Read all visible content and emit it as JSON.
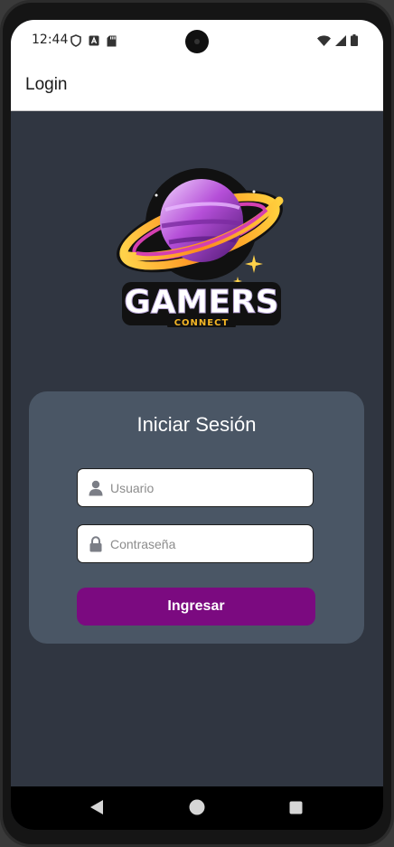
{
  "status_bar": {
    "time": "12:44"
  },
  "app_bar": {
    "title": "Login"
  },
  "logo": {
    "brand": "GAMERS",
    "tagline": "CONNECT"
  },
  "login_card": {
    "title": "Iniciar Sesión",
    "username_placeholder": "Usuario",
    "password_placeholder": "Contraseña",
    "submit_label": "Ingresar"
  },
  "colors": {
    "background": "#303641",
    "card": "#4a5665",
    "button": "#7b0a80"
  },
  "icons": {
    "status_left": [
      "shield-icon",
      "font-icon",
      "sd-card-icon"
    ],
    "status_right": [
      "wifi-icon",
      "signal-icon",
      "battery-icon"
    ],
    "fields": [
      "person-icon",
      "lock-icon"
    ],
    "navigation": [
      "back-icon",
      "home-icon",
      "recent-apps-icon"
    ]
  }
}
